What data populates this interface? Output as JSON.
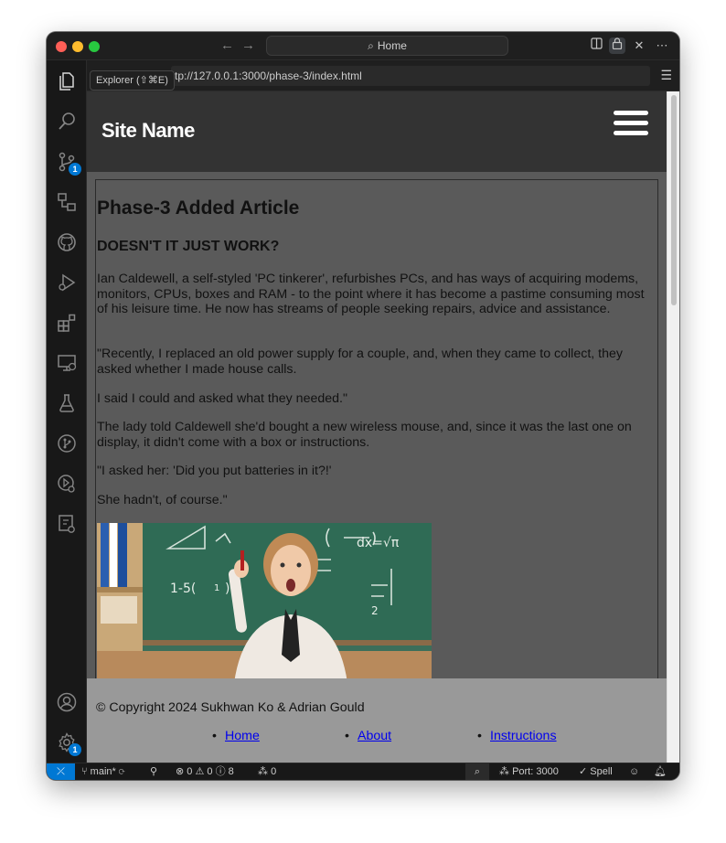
{
  "titlebar": {
    "search_label": "Home",
    "back_icon": "arrow-left-icon",
    "forward_icon": "arrow-right-icon"
  },
  "tooltip": {
    "text": "Explorer (⇧⌘E)"
  },
  "activity_bar": {
    "source_control_badge": "1",
    "settings_badge": "1"
  },
  "browser": {
    "url": "http://127.0.0.1:3000/phase-3/index.html"
  },
  "site": {
    "name": "Site Name",
    "article": {
      "title": "Phase-3 Added Article",
      "subtitle": "DOESN'T IT JUST WORK?",
      "paragraphs": [
        "Ian Caldewell, a self-styled 'PC tinkerer', refurbishes PCs, and has ways of acquiring modems, monitors, CPUs, boxes and RAM - to the point where it has become a pastime consuming most of his leisure time. He now has streams of people seeking repairs, advice and assistance.",
        "\"Recently, I replaced an old power supply for a couple, and, when they came to collect, they asked whether I made house calls.",
        "I said I could and asked what they needed.\"",
        "The lady told Caldewell she'd bought a new wireless mouse, and, since it was the last one on display, it didn't come with a box or instructions.",
        "\"I asked her: 'Did you put batteries in it?!'",
        "She hadn't, of course.\""
      ],
      "image_alt": "Surprised woman pointing up in front of a chalkboard"
    },
    "footer": {
      "copyright": "© Copyright 2024 Sukhwan Ko & Adrian Gould",
      "links": [
        "Home",
        "About",
        "Instructions"
      ]
    }
  },
  "statusbar": {
    "branch": "main*",
    "errors": "0",
    "warnings": "0",
    "infos": "8",
    "ports": "0",
    "port_label": "Port: 3000",
    "spell_label": "Spell"
  },
  "colors": {
    "accent": "#0078d4",
    "site_header": "#333333",
    "main_bg": "#5a5a5a",
    "footer_bg": "#999999",
    "link": "#0000ee"
  }
}
